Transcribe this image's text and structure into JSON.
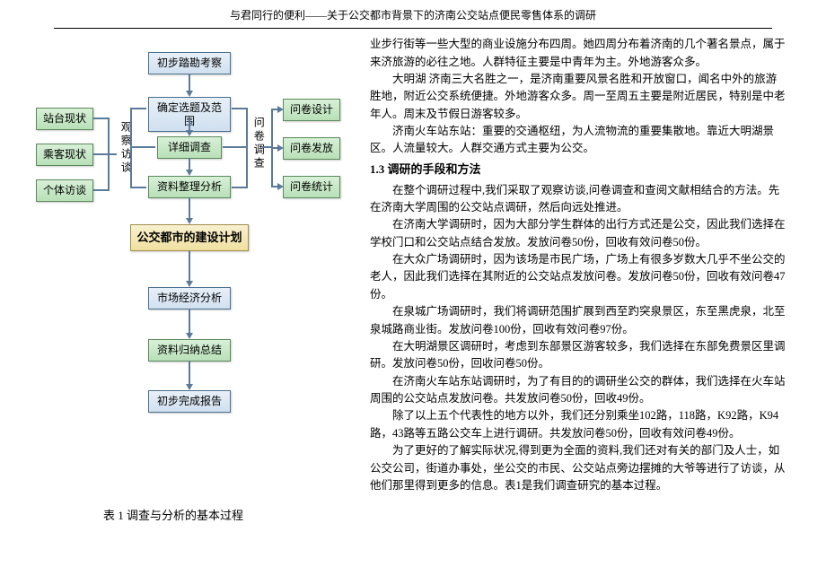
{
  "header": "与君同行的便利——关于公交都市背景下的济南公交站点便民零售体系的调研",
  "flowchart": {
    "n1": "初步踏勘考察",
    "n2": "确定选题及范围",
    "n3": "详细调查",
    "n4": "资料整理分析",
    "n5": "公交都市的建设计划",
    "n6": "市场经济分析",
    "n7": "资料归纳总结",
    "n8": "初步完成报告",
    "left1": "站台现状",
    "left2": "乘客现状",
    "left3": "个体访谈",
    "right1": "问卷设计",
    "right2": "问卷发放",
    "right3": "问卷统计",
    "label_left": "观察访谈",
    "label_right": "问卷调查"
  },
  "caption": "表 1    调查与分析的基本过程",
  "body": {
    "p1": "业步行街等一些大型的商业设施分布四周。她四周分布着济南的几个著名景点，属于来济旅游的必往之地。人群特征主要是中青年为主。外地游客众多。",
    "p2": "大明湖  济南三大名胜之一，是济南重要风景名胜和开放窗口，闻名中外的旅游胜地，附近公交系统便捷。外地游客众多。周一至周五主要是附近居民，特别是中老年人。周末及节假日游客较多。",
    "p3": "济南火车站东站：重要的交通枢纽，为人流物流的重要集散地。靠近大明湖景区。人流量较大。人群交通方式主要为公交。",
    "h1": "1.3 调研的手段和方法",
    "p4": "在整个调研过程中,我们采取了观察访谈,问卷调查和查阅文献相结合的方法。先在济南大学周围的公交站点调研，然后向远处推进。",
    "p5": "在济南大学调研时，因为大部分学生群体的出行方式还是公交，因此我们选择在学校门口和公交站点结合发放。发放问卷50份，回收有效问卷50份。",
    "p6": "在大众广场调研时，因为该场是市民广场，广场上有很多岁数大几乎不坐公交的老人，因此我们选择在其附近的公交站点发放问卷。发放问卷50份，回收有效问卷47份。",
    "p7": "在泉城广场调研时，我们将调研范围扩展到西至趵突泉景区，东至黑虎泉，北至泉城路商业街。发放问卷100份，回收有效问卷97份。",
    "p8": "在大明湖景区调研时，考虑到东部景区游客较多，我们选择在东部免费景区里调研。发放问卷50份，回收问卷50份。",
    "p9": "在济南火车站东站调研时，为了有目的的调研坐公交的群体，我们选择在火车站周围的公交站点发放问卷。共发放问卷50份，回收49份。",
    "p10": "除了以上五个代表性的地方以外，我们还分别乘坐102路，118路，K92路，K94路，43路等五路公交车上进行调研。共发放问卷50份，回收有效问卷49份。",
    "p11": "为了更好的了解实际状况,得到更为全面的资料,我们还对有关的部门及人士，如公交公司，街道办事处，坐公交的市民、公交站点旁边摆摊的大爷等进行了访谈，从他们那里得到更多的信息。表1是我们调查研究的基本过程。"
  }
}
